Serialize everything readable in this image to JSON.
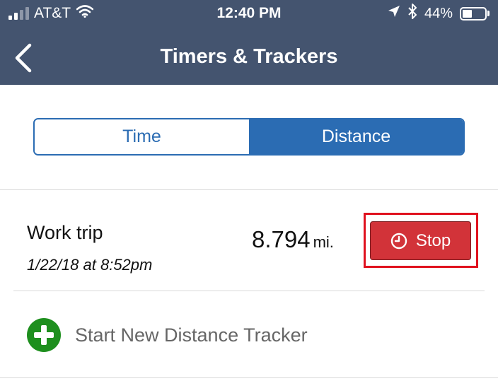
{
  "status_bar": {
    "carrier": "AT&T",
    "time": "12:40 PM",
    "battery_percent": "44%",
    "battery_level": 0.44,
    "icons": [
      "signal-icon",
      "wifi-icon",
      "location-icon",
      "bluetooth-icon",
      "battery-icon"
    ]
  },
  "header": {
    "title": "Timers & Trackers",
    "back_icon": "chevron-left-icon"
  },
  "tabs": [
    {
      "label": "Time",
      "active": false
    },
    {
      "label": "Distance",
      "active": true
    }
  ],
  "tracker": {
    "name": "Work trip",
    "date": "1/22/18 at 8:52pm",
    "distance_value": "8.794",
    "distance_unit": "mi.",
    "stop_label": "Stop",
    "stop_icon": "clock-icon"
  },
  "add_tracker": {
    "label": "Start New Distance Tracker",
    "icon": "plus-circle-icon"
  },
  "colors": {
    "nav_bar": "#44546f",
    "accent_blue": "#2b6cb3",
    "stop_red": "#d23339",
    "highlight_red": "#e0121f",
    "add_green": "#1e8f1e",
    "muted_text": "#666666"
  }
}
